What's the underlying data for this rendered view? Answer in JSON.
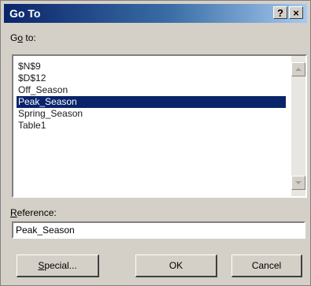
{
  "window": {
    "title": "Go To",
    "help_label": "?",
    "close_label": "×"
  },
  "goto": {
    "label_prefix": "G",
    "label_underlined": "o",
    "label_suffix": " to:",
    "items": [
      "$N$9",
      "$D$12",
      "Off_Season",
      "Peak_Season",
      "Spring_Season",
      "Table1"
    ],
    "selected": "Peak_Season"
  },
  "reference": {
    "label_underlined": "R",
    "label_suffix": "eference:",
    "value": "Peak_Season"
  },
  "buttons": {
    "special_underlined": "S",
    "special_suffix": "pecial...",
    "ok": "OK",
    "cancel": "Cancel"
  },
  "colors": {
    "title_bar": "#0a246a",
    "selection": "#0a246a",
    "dialog_bg": "#d4d0c8"
  }
}
